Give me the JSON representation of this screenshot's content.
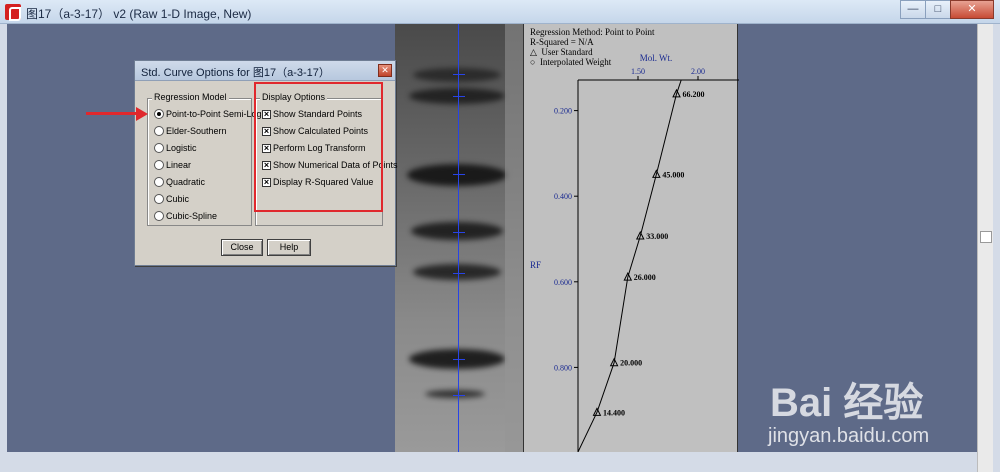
{
  "window": {
    "title": "图17（a-3-17） v2 (Raw 1-D Image, New)"
  },
  "panel": {
    "method_line": "Regression Method: Point to Point",
    "rsq_line": "R-Squared = N/A",
    "legend_user": "User Standard",
    "legend_interp": "Interpolated Weight",
    "x_title": "Mol. Wt.",
    "y_title": "RF"
  },
  "chart_data": {
    "type": "line",
    "x_title": "Mol. Wt.",
    "y_title": "RF",
    "x_ticks": [
      "1.50",
      "2.00"
    ],
    "y_ticks": [
      "0.200",
      "0.400",
      "0.600",
      "0.800"
    ],
    "points": [
      {
        "label": "66.200",
        "logmw": 1.821,
        "rf": 0.161
      },
      {
        "label": "45.000",
        "logmw": 1.653,
        "rf": 0.349
      },
      {
        "label": "33.000",
        "logmw": 1.519,
        "rf": 0.493
      },
      {
        "label": "26.000",
        "logmw": 1.415,
        "rf": 0.589
      },
      {
        "label": "20.000",
        "logmw": 1.301,
        "rf": 0.789
      },
      {
        "label": "14.400",
        "logmw": 1.158,
        "rf": 0.905
      }
    ]
  },
  "dialog": {
    "title": "Std. Curve Options for 图17（a-3-17）",
    "regression_legend": "Regression Model",
    "regression_options": [
      "Point-to-Point Semi-Log",
      "Elder-Southern",
      "Logistic",
      "Linear",
      "Quadratic",
      "Cubic",
      "Cubic-Spline"
    ],
    "display_legend": "Display Options",
    "display_options": [
      "Show Standard Points",
      "Show Calculated Points",
      "Perform Log Transform",
      "Show Numerical Data of Points",
      "Display R-Squared Value"
    ],
    "close_label": "Close",
    "help_label": "Help"
  },
  "watermark": {
    "main": "Bai 经验",
    "url": "jingyan.baidu.com"
  }
}
